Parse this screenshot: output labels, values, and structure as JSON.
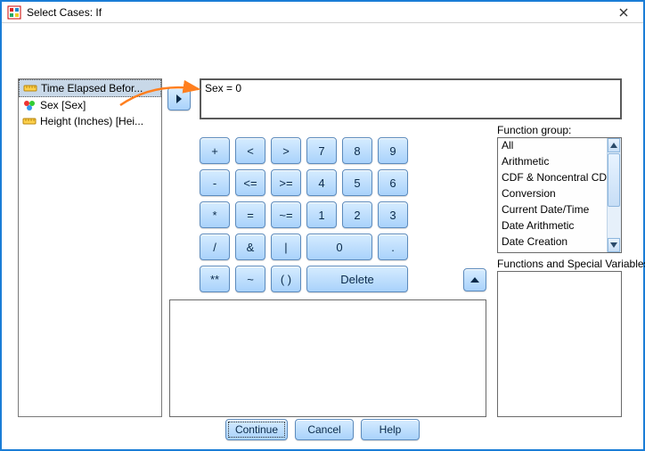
{
  "title": "Select Cases: If",
  "expression": "Sex = 0",
  "variables": [
    {
      "label": "Time Elapsed Befor...",
      "iconType": "ruler"
    },
    {
      "label": "Sex [Sex]",
      "iconType": "nominal"
    },
    {
      "label": "Height (Inches) [Hei...",
      "iconType": "ruler"
    }
  ],
  "keypad": {
    "rows": [
      [
        "+",
        "<",
        ">",
        "7",
        "8",
        "9"
      ],
      [
        "-",
        "<=",
        ">=",
        "4",
        "5",
        "6"
      ],
      [
        "*",
        "=",
        "~=",
        "1",
        "2",
        "3"
      ],
      [
        "/",
        "&",
        "|",
        "0",
        "."
      ]
    ],
    "lastRow": {
      "pow": "**",
      "tilde": "~",
      "paren": "( )",
      "delete": "Delete"
    }
  },
  "functionGroupLabel": "Function group:",
  "functionGroups": [
    "All",
    "Arithmetic",
    "CDF & Noncentral CDF",
    "Conversion",
    "Current Date/Time",
    "Date Arithmetic",
    "Date Creation"
  ],
  "fsvLabel": "Functions and Special Variables:",
  "footer": {
    "continue": "Continue",
    "cancel": "Cancel",
    "help": "Help"
  }
}
